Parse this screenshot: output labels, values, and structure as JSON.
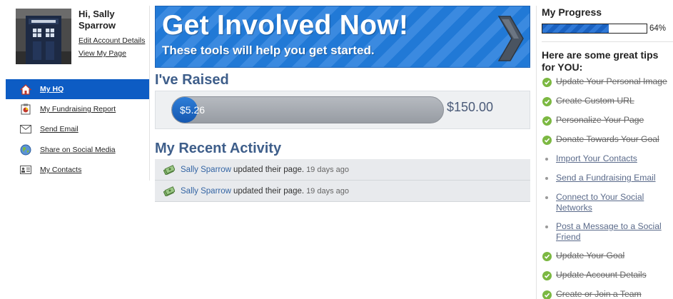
{
  "user": {
    "greeting": "Hi, Sally Sparrow",
    "edit_account": "Edit Account Details",
    "view_page": "View My Page"
  },
  "nav": [
    {
      "label": "My HQ",
      "icon": "home-icon",
      "active": true
    },
    {
      "label": "My Fundraising Report",
      "icon": "report-icon",
      "active": false
    },
    {
      "label": "Send Email",
      "icon": "envelope-icon",
      "active": false
    },
    {
      "label": "Share on Social Media",
      "icon": "globe-icon",
      "active": false
    },
    {
      "label": "My Contacts",
      "icon": "contacts-card-icon",
      "active": false
    }
  ],
  "banner": {
    "title": "Get Involved Now!",
    "subtitle": "These tools will help you get started.",
    "icon": "chevron-right-icon"
  },
  "raised": {
    "title": "I've Raised",
    "amount": "$5.26",
    "goal": "$150.00",
    "fraction": 0.035
  },
  "activity": {
    "title": "My Recent Activity",
    "items": [
      {
        "name": "Sally Sparrow",
        "action": "updated their page.",
        "time": "19 days ago",
        "icon": "money-icon"
      },
      {
        "name": "Sally Sparrow",
        "action": "updated their page.",
        "time": "19 days ago",
        "icon": "money-icon"
      }
    ]
  },
  "progress": {
    "title": "My Progress",
    "percent": 64,
    "percent_label": "64%"
  },
  "tips": {
    "title": "Here are some great tips for YOU:",
    "items": [
      {
        "label": "Update Your Personal Image",
        "done": true
      },
      {
        "label": "Create Custom URL",
        "done": true
      },
      {
        "label": "Personalize Your Page",
        "done": true
      },
      {
        "label": "Donate Towards Your Goal",
        "done": true
      },
      {
        "label": "Import Your Contacts",
        "done": false
      },
      {
        "label": "Send a Fundraising Email",
        "done": false
      },
      {
        "label": "Connect to Your Social Networks",
        "done": false
      },
      {
        "label": "Post a Message to a Social Friend",
        "done": false
      },
      {
        "label": "Update Your Goal",
        "done": true
      },
      {
        "label": "Update Account Details",
        "done": true
      },
      {
        "label": "Create or Join a Team",
        "done": true
      }
    ]
  },
  "colors": {
    "nav_active": "#0d5cc4",
    "section_title": "#3e5e8a",
    "check_green": "#7cb842",
    "link_blue": "#3465a4"
  }
}
